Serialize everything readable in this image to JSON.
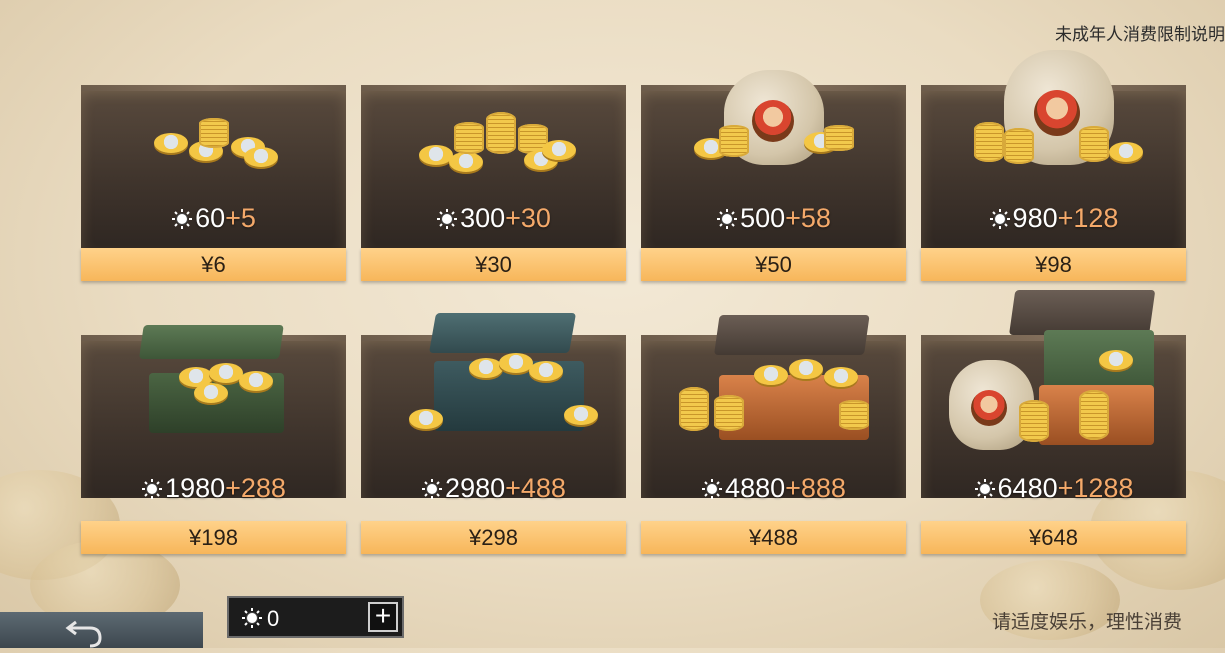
{
  "header": {
    "minor_note": "未成年人消费限制说明"
  },
  "packs": [
    {
      "amount": "60",
      "bonus": "+5",
      "price": "¥6"
    },
    {
      "amount": "300",
      "bonus": "+30",
      "price": "¥30"
    },
    {
      "amount": "500",
      "bonus": "+58",
      "price": "¥50"
    },
    {
      "amount": "980",
      "bonus": "+128",
      "price": "¥98"
    },
    {
      "amount": "1980",
      "bonus": "+288",
      "price": "¥198"
    },
    {
      "amount": "2980",
      "bonus": "+488",
      "price": "¥298"
    },
    {
      "amount": "4880",
      "bonus": "+888",
      "price": "¥488"
    },
    {
      "amount": "6480",
      "bonus": "+1288",
      "price": "¥648"
    }
  ],
  "wallet": {
    "balance": "0",
    "add_label": "+"
  },
  "footer": {
    "note": "请适度娱乐，理性消费"
  },
  "colors": {
    "price_button": "#f7b65a",
    "bonus_text": "#f4a96a",
    "card_bg": "#3f342c"
  },
  "icons": {
    "currency": "sun-coin-icon",
    "back": "back-arrow-icon",
    "add": "plus-icon"
  }
}
